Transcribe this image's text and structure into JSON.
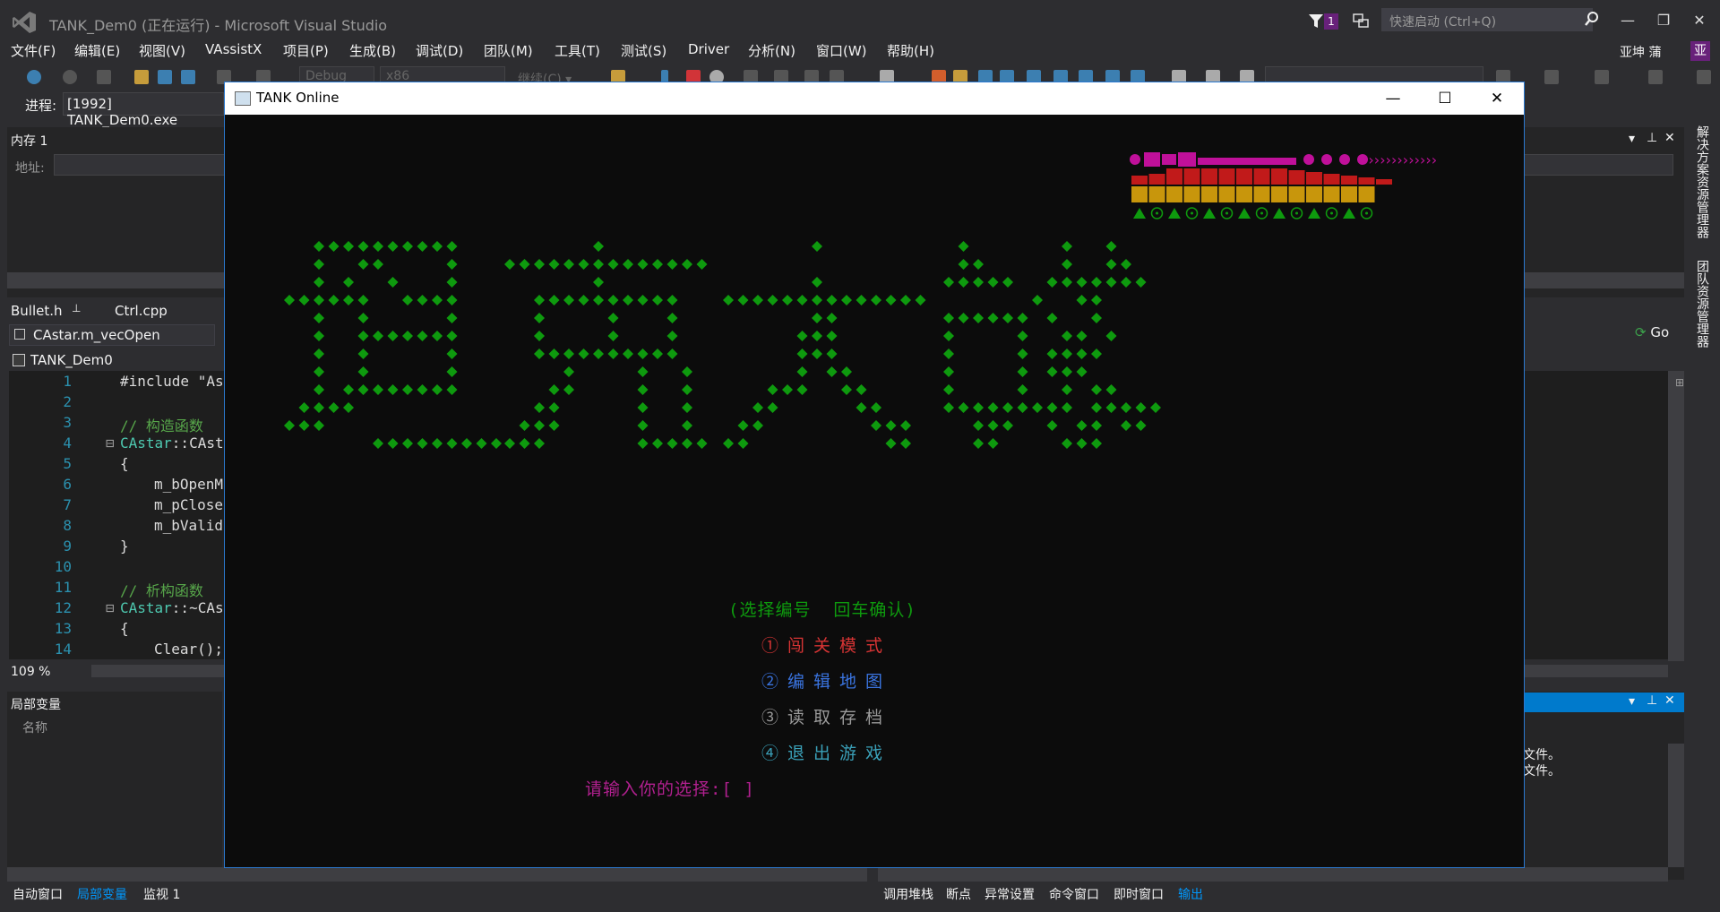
{
  "window": {
    "title": "TANK_Dem0 (正在运行) - Microsoft Visual Studio",
    "notification_count": "1",
    "quick_launch_placeholder": "快速启动 (Ctrl+Q)",
    "user_name": "亚坤 蒲",
    "user_initial": "亚"
  },
  "menu": [
    "文件(F)",
    "编辑(E)",
    "视图(V)",
    "VAssistX",
    "项目(P)",
    "生成(B)",
    "调试(D)",
    "团队(M)",
    "工具(T)",
    "测试(S)",
    "Driver",
    "分析(N)",
    "窗口(W)",
    "帮助(H)"
  ],
  "toolbar": {
    "config": "Debug",
    "platform": "x86",
    "continue": "继续(C) ▾"
  },
  "process": {
    "label": "进程:",
    "value": "[1992] TANK_Dem0.exe"
  },
  "memory_pane": {
    "title": "内存 1",
    "address_label": "地址:"
  },
  "editor": {
    "tabs": [
      {
        "label": "Bullet.h"
      },
      {
        "label": "Ctrl.cpp"
      }
    ],
    "nav_member": "CAstar.m_vecOpen",
    "nav_right": "Go",
    "project": "TANK_Dem0",
    "zoom": "109 %",
    "lines": [
      {
        "n": "1",
        "indent": 0,
        "fold": "",
        "parts": [
          {
            "t": "#include \"As",
            "c": "plain"
          }
        ]
      },
      {
        "n": "2",
        "indent": 0,
        "fold": "",
        "parts": []
      },
      {
        "n": "3",
        "indent": 0,
        "fold": "",
        "parts": [
          {
            "t": "// 构造函数",
            "c": "cmt"
          }
        ]
      },
      {
        "n": "4",
        "indent": 0,
        "fold": "⊟",
        "parts": [
          {
            "t": "CAstar",
            "c": "cls"
          },
          {
            "t": "::CAst",
            "c": "plain"
          }
        ]
      },
      {
        "n": "5",
        "indent": 0,
        "fold": "",
        "parts": [
          {
            "t": "{",
            "c": "plain"
          }
        ]
      },
      {
        "n": "6",
        "indent": 1,
        "fold": "",
        "parts": [
          {
            "t": "m_bOpenM",
            "c": "plain"
          }
        ]
      },
      {
        "n": "7",
        "indent": 1,
        "fold": "",
        "parts": [
          {
            "t": "m_pClose",
            "c": "plain"
          }
        ]
      },
      {
        "n": "8",
        "indent": 1,
        "fold": "",
        "parts": [
          {
            "t": "m_bValid",
            "c": "plain"
          }
        ]
      },
      {
        "n": "9",
        "indent": 0,
        "fold": "",
        "parts": [
          {
            "t": "}",
            "c": "plain"
          }
        ]
      },
      {
        "n": "10",
        "indent": 0,
        "fold": "",
        "parts": []
      },
      {
        "n": "11",
        "indent": 0,
        "fold": "",
        "parts": [
          {
            "t": "// 析构函数",
            "c": "cmt"
          }
        ]
      },
      {
        "n": "12",
        "indent": 0,
        "fold": "⊟",
        "parts": [
          {
            "t": "CAstar",
            "c": "cls"
          },
          {
            "t": "::~CAs",
            "c": "plain"
          }
        ]
      },
      {
        "n": "13",
        "indent": 0,
        "fold": "",
        "parts": [
          {
            "t": "{",
            "c": "plain"
          }
        ]
      },
      {
        "n": "14",
        "indent": 1,
        "fold": "",
        "parts": [
          {
            "t": "Clear();",
            "c": "plain"
          }
        ]
      }
    ]
  },
  "locals_pane": {
    "title": "局部变量",
    "column": "名称"
  },
  "output_pane": {
    "lines": [
      "文件。",
      "文件。"
    ]
  },
  "bottom_tabs_left": [
    {
      "label": "自动窗口",
      "active": false
    },
    {
      "label": "局部变量",
      "active": true
    },
    {
      "label": "监视 1",
      "active": false
    }
  ],
  "bottom_tabs_right": [
    {
      "label": "调用堆栈",
      "active": false
    },
    {
      "label": "断点",
      "active": false
    },
    {
      "label": "异常设置",
      "active": false
    },
    {
      "label": "命令窗口",
      "active": false
    },
    {
      "label": "即时窗口",
      "active": false
    },
    {
      "label": "输出",
      "active": true
    }
  ],
  "side_tabs": [
    "解决方案资源管理器",
    "团队资源管理器"
  ],
  "console": {
    "title": "TANK Online",
    "hint": "(选择编号  回车确认)",
    "options": [
      {
        "label": "①闯关模式",
        "color": "#d73434"
      },
      {
        "label": "②编辑地图",
        "color": "#3a74e0"
      },
      {
        "label": "③读取存档",
        "color": "#9a9a9a"
      },
      {
        "label": "④退出游戏",
        "color": "#3aa0b8"
      }
    ],
    "prompt": "请输入你的选择:[ ]",
    "logo_color": "#0e9a0e"
  }
}
